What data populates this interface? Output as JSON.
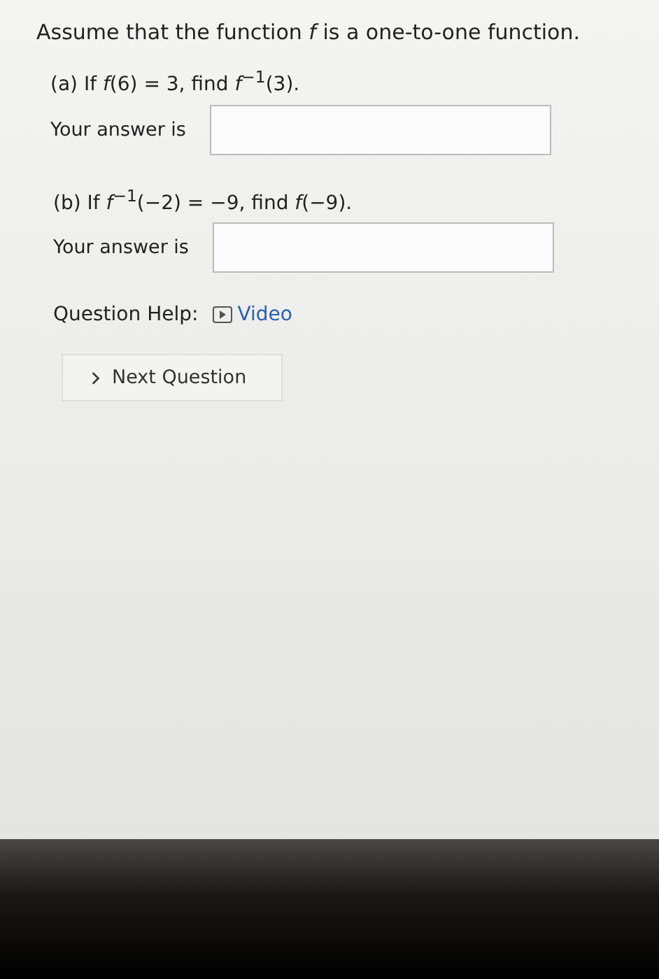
{
  "title": "Assume that the function *f* is a one-to-one function.",
  "parts": [
    {
      "question": "(a) If *f*(6) = 3, find *f*$^{−1}$(3).",
      "answer_label": "Your answer is"
    },
    {
      "question": "(b) If *f*$^{−1}$(−2) = −9, find *f*(−9).",
      "answer_label": "Your answer is"
    }
  ],
  "help": {
    "label": "Question Help:",
    "link": "Video"
  },
  "next_button": "Next Question"
}
